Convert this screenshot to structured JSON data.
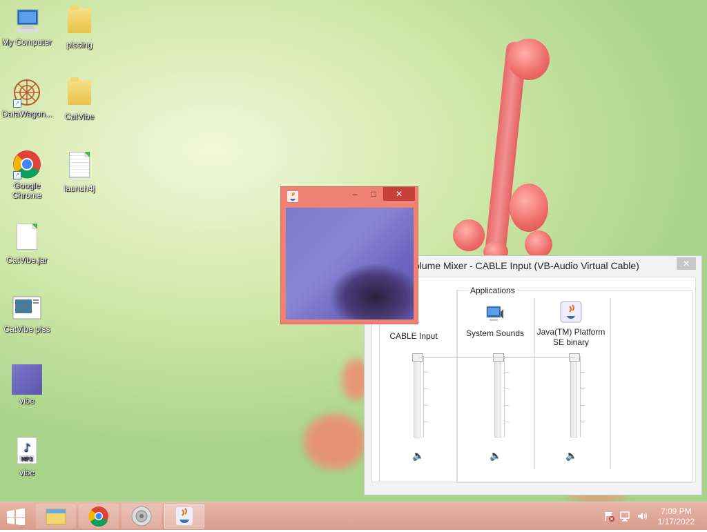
{
  "desktop": {
    "icons": [
      {
        "label": "My Computer",
        "icon": "computer-icon"
      },
      {
        "label": "pissing",
        "icon": "folder-icon"
      },
      {
        "label": "DataWagon...",
        "icon": "datawagon-icon"
      },
      {
        "label": "CatVibe",
        "icon": "folder-icon"
      },
      {
        "label": "Google Chrome",
        "icon": "chrome-icon"
      },
      {
        "label": "launch4j",
        "icon": "document-icon"
      },
      {
        "label": "CatVibe.jar",
        "icon": "document-icon"
      },
      {
        "label": "CatVibe piss",
        "icon": "image-icon"
      },
      {
        "label": "vibe",
        "icon": "image-icon"
      },
      {
        "label": "vibe",
        "icon": "mp3-icon"
      }
    ]
  },
  "java_window": {
    "minimize": "–",
    "maximize": "□",
    "close": "✕"
  },
  "mixer": {
    "title": "olume Mixer - CABLE Input (VB-Audio Virtual Cable)",
    "close": "✕",
    "applications_label": "Applications",
    "channels": [
      {
        "name": "CABLE Input",
        "icon": "speaker-device-icon"
      },
      {
        "name": "System Sounds",
        "icon": "system-sounds-icon"
      },
      {
        "name": "Java(TM) Platform SE binary",
        "icon": "java-icon"
      }
    ]
  },
  "taskbar": {
    "time": "7:09 PM",
    "date": "1/17/2022",
    "items": [
      "file-explorer-icon",
      "chrome-icon",
      "speaker-icon",
      "java-icon"
    ]
  },
  "colors": {
    "taskbar": "#d99c8c",
    "java_frame": "#f08274",
    "accent": "#2a6fd0"
  }
}
